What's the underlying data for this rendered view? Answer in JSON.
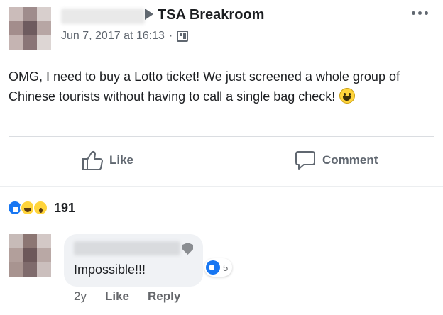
{
  "post": {
    "group_name": "TSA Breakroom",
    "timestamp": "Jun 7, 2017 at 16:13",
    "separator": "·",
    "audience_icon": "group-icon",
    "more_icon": "more-options-icon",
    "text": "OMG, I need to buy a Lotto ticket! We just screened a whole group of Chinese tourists without having to call a single bag check!",
    "emoji": "smiling-face-icon"
  },
  "actions": {
    "like_label": "Like",
    "comment_label": "Comment"
  },
  "reactions": {
    "types": [
      "like",
      "haha",
      "wow"
    ],
    "count": "191"
  },
  "comment": {
    "text": "Impossible!!!",
    "reaction_type": "like",
    "reaction_count": "5",
    "time": "2y",
    "like_label": "Like",
    "reply_label": "Reply"
  },
  "colors": {
    "accent": "#1877f2",
    "text_primary": "#1c1e21",
    "text_secondary": "#606770",
    "bubble": "#f0f2f5"
  }
}
